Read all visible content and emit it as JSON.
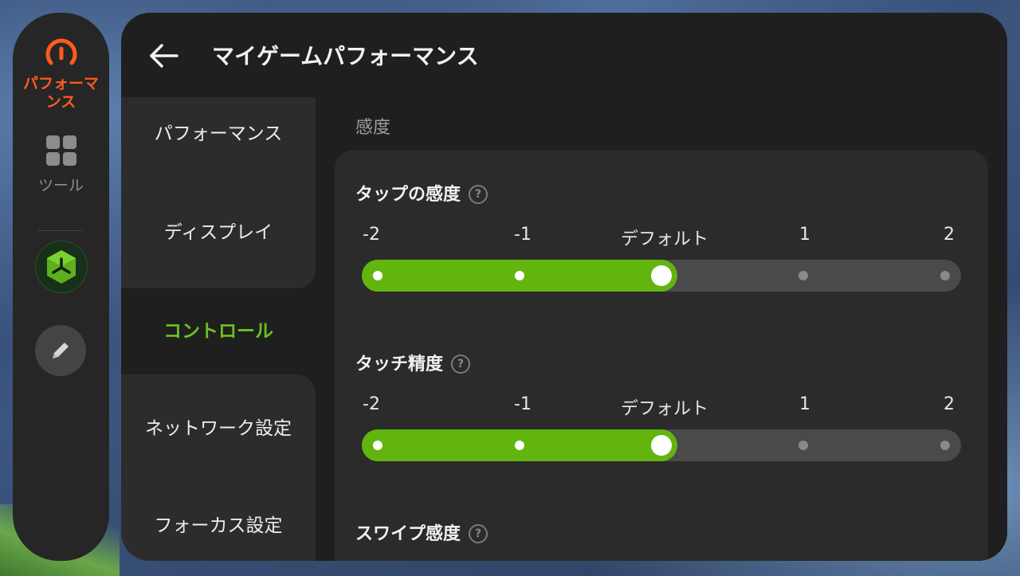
{
  "rail": {
    "performance_label": "パフォーマンス",
    "tools_label": "ツール",
    "accent_color": "#ff5a1f"
  },
  "header": {
    "title": "マイゲームパフォーマンス",
    "back_icon": "arrow-left-icon"
  },
  "subnav": {
    "items": [
      {
        "label": "パフォーマンス",
        "active": false
      },
      {
        "label": "ディスプレイ",
        "active": false
      },
      {
        "label": "コントロール",
        "active": true
      },
      {
        "label": "ネットワーク設定",
        "active": false
      },
      {
        "label": "フォーカス設定",
        "active": false
      }
    ],
    "active_color": "#6cc11f"
  },
  "main": {
    "section_label": "感度",
    "settings": [
      {
        "title": "タップの感度",
        "help": "?",
        "ticks": [
          "-2",
          "-1",
          "デフォルト",
          "1",
          "2"
        ],
        "level_index": 2
      },
      {
        "title": "タッチ精度",
        "help": "?",
        "ticks": [
          "-2",
          "-1",
          "デフォルト",
          "1",
          "2"
        ],
        "level_index": 2
      },
      {
        "title": "スワイプ感度",
        "help": "?"
      }
    ],
    "slider_color": "#62b50f"
  }
}
